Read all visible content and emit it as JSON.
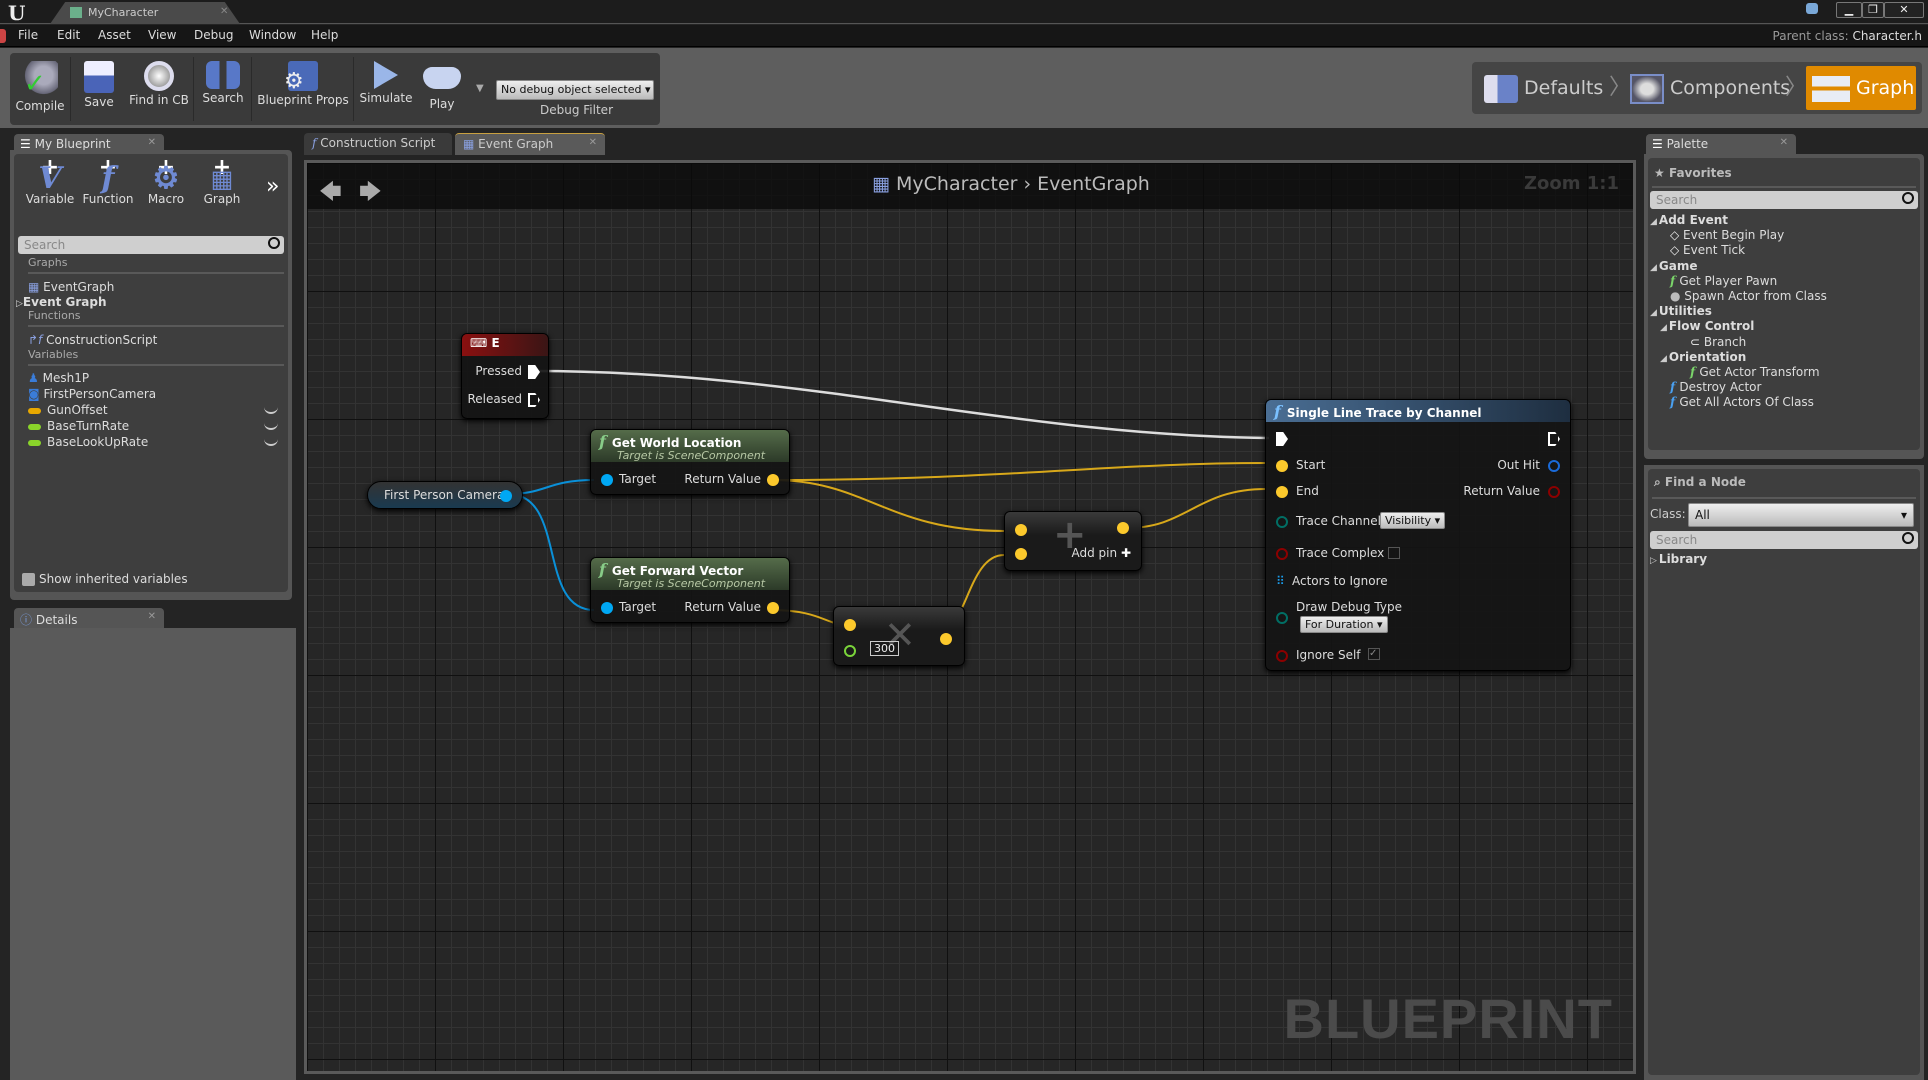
{
  "window": {
    "tab_title": "MyCharacter",
    "parent_class_label": "Parent class:",
    "parent_class_value": "Character.h",
    "controls": [
      "minimize",
      "restore",
      "close"
    ]
  },
  "menu": [
    "File",
    "Edit",
    "Asset",
    "View",
    "Debug",
    "Window",
    "Help"
  ],
  "toolbar": {
    "buttons": [
      {
        "label": "Compile",
        "icon": "compile-icon"
      },
      {
        "label": "Save",
        "icon": "save-icon"
      },
      {
        "label": "Find in CB",
        "icon": "find-in-cb-icon"
      },
      {
        "label": "Search",
        "icon": "binoculars-icon"
      },
      {
        "label": "Blueprint Props",
        "icon": "blueprint-props-icon"
      },
      {
        "label": "Simulate",
        "icon": "simulate-icon"
      },
      {
        "label": "Play",
        "icon": "gamepad-icon"
      }
    ],
    "debug_object": "No debug object selected",
    "debug_filter_label": "Debug Filter"
  },
  "modes": [
    {
      "label": "Defaults",
      "active": false
    },
    {
      "label": "Components",
      "active": false
    },
    {
      "label": "Graph",
      "active": true
    }
  ],
  "colors": {
    "accent": "#e08a00",
    "exec": "#ffffff",
    "vector": "#fcc92c",
    "object": "#00a8f4",
    "float": "#9ce345",
    "bool": "#8c0000",
    "byte": "#016e64"
  },
  "my_blueprint": {
    "tab_label": "My Blueprint",
    "add_buttons": [
      "Variable",
      "Function",
      "Macro",
      "Graph"
    ],
    "search_placeholder": "Search",
    "sections": {
      "graphs": "Graphs",
      "functions": "Functions",
      "variables": "Variables"
    },
    "graphs": [
      "EventGraph",
      "Event Graph"
    ],
    "functions": [
      "ConstructionScript"
    ],
    "variables": [
      {
        "name": "Mesh1P",
        "type": "mesh"
      },
      {
        "name": "FirstPersonCamera",
        "type": "camera"
      },
      {
        "name": "GunOffset",
        "type": "vector",
        "color": "#e8a800"
      },
      {
        "name": "BaseTurnRate",
        "type": "float",
        "color": "#8ad42a"
      },
      {
        "name": "BaseLookUpRate",
        "type": "float",
        "color": "#8ad42a"
      }
    ],
    "show_inherited_label": "Show inherited variables",
    "show_inherited_checked": false
  },
  "details": {
    "tab_label": "Details"
  },
  "graph_tabs": [
    {
      "label": "Construction Script",
      "active": false
    },
    {
      "label": "Event Graph",
      "active": true
    }
  ],
  "graph": {
    "breadcrumb": [
      "MyCharacter",
      "EventGraph"
    ],
    "zoom": "Zoom 1:1",
    "watermark": "BLUEPRINT",
    "nodes": {
      "key_e": {
        "title": "E",
        "pins": [
          "Pressed",
          "Released"
        ]
      },
      "camera": {
        "title": "First Person Camera"
      },
      "get_world_location": {
        "title": "Get World Location",
        "subtitle": "Target is SceneComponent",
        "in": "Target",
        "out": "Return Value"
      },
      "get_forward_vector": {
        "title": "Get Forward Vector",
        "subtitle": "Target is SceneComponent",
        "in": "Target",
        "out": "Return Value"
      },
      "multiply": {
        "value": "300"
      },
      "add": {
        "add_pin_label": "Add pin"
      },
      "line_trace": {
        "title": "Single Line Trace by Channel",
        "inputs": [
          "Start",
          "End",
          "Trace Channel",
          "Trace Complex",
          "Actors to Ignore",
          "Draw Debug Type",
          "Ignore Self"
        ],
        "outputs": [
          "Out Hit",
          "Return Value"
        ],
        "trace_channel_value": "Visibility",
        "draw_debug_value": "For Duration",
        "trace_complex": false,
        "ignore_self": true
      }
    }
  },
  "palette": {
    "tab_label": "Palette",
    "favorites_label": "Favorites",
    "search_placeholder": "Search",
    "tree": [
      {
        "label": "Add Event",
        "level": 0,
        "category": true
      },
      {
        "label": "Event Begin Play",
        "level": 1,
        "icon": "event-icon"
      },
      {
        "label": "Event Tick",
        "level": 1,
        "icon": "event-icon"
      },
      {
        "label": "Game",
        "level": 0,
        "category": true
      },
      {
        "label": "Get Player Pawn",
        "level": 1,
        "icon": "function-icon-green"
      },
      {
        "label": "Spawn Actor from Class",
        "level": 1,
        "icon": "spawn-icon"
      },
      {
        "label": "Utilities",
        "level": 0,
        "category": true
      },
      {
        "label": "Flow Control",
        "level": 1,
        "category": true
      },
      {
        "label": "Branch",
        "level": 2,
        "icon": "branch-icon"
      },
      {
        "label": "Orientation",
        "level": 1,
        "category": true
      },
      {
        "label": "Get Actor Transform",
        "level": 2,
        "icon": "function-icon-green"
      },
      {
        "label": "Destroy Actor",
        "level": 1,
        "icon": "function-icon-blue"
      },
      {
        "label": "Get All Actors Of Class",
        "level": 1,
        "icon": "function-icon-blue"
      }
    ],
    "find_node_label": "Find a Node",
    "class_label": "Class:",
    "class_value": "All",
    "find_search_placeholder": "Search",
    "library_label": "Library"
  }
}
